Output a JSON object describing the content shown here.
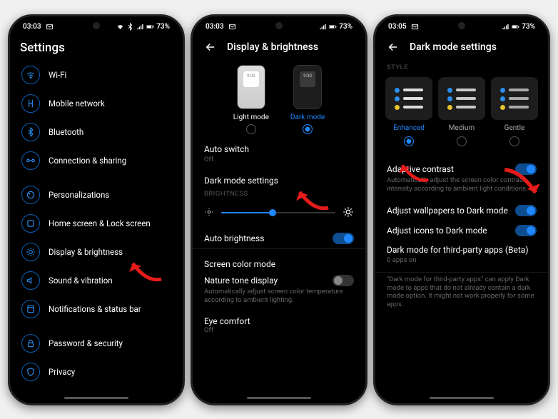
{
  "status": {
    "time_a": "03:03",
    "time_b": "03:03",
    "time_c": "03:05",
    "battery": "73%"
  },
  "screen1": {
    "title": "Settings",
    "items": [
      {
        "name": "wifi",
        "label": "Wi-Fi"
      },
      {
        "name": "mobile",
        "label": "Mobile network"
      },
      {
        "name": "bluetooth",
        "label": "Bluetooth"
      },
      {
        "name": "connection",
        "label": "Connection & sharing"
      },
      {
        "name": "personal",
        "label": "Personalizations"
      },
      {
        "name": "home",
        "label": "Home screen & Lock screen"
      },
      {
        "name": "display",
        "label": "Display & brightness"
      },
      {
        "name": "sound",
        "label": "Sound & vibration"
      },
      {
        "name": "notif",
        "label": "Notifications & status bar"
      },
      {
        "name": "security",
        "label": "Password & security"
      },
      {
        "name": "privacy",
        "label": "Privacy"
      }
    ]
  },
  "screen2": {
    "title": "Display & brightness",
    "light_label": "Light mode",
    "dark_label": "Dark mode",
    "mock_time_a": "9:00",
    "mock_time_b": "9:30",
    "autoswitch": "Auto switch",
    "autoswitch_sub": "Off",
    "darkmode_settings": "Dark mode settings",
    "brightness_caption": "BRIGHTNESS",
    "slider_pct": 45,
    "auto_brightness": "Auto brightness",
    "screen_color": "Screen color mode",
    "nature_tone": "Nature tone display",
    "nature_tone_sub": "Automatically adjust screen color temperature according to ambient lighting.",
    "eye_comfort": "Eye comfort",
    "eye_comfort_sub": "Off"
  },
  "screen3": {
    "title": "Dark mode settings",
    "style_caption": "STYLE",
    "styles": [
      {
        "label": "Enhanced",
        "selected": true
      },
      {
        "label": "Medium",
        "selected": false
      },
      {
        "label": "Gentle",
        "selected": false
      }
    ],
    "adaptive": "Adaptive contrast",
    "adaptive_sub": "Automatically adjust the screen color contrast intensity according to ambient light conditions.",
    "wallpapers": "Adjust wallpapers to Dark mode",
    "icons": "Adjust icons to Dark mode",
    "thirdparty": "Dark mode for third-party apps (Beta)",
    "thirdparty_sub": "0 apps on",
    "footer": "\"Dark mode for third-party apps\" can apply Dark mode to apps that do not already contain a dark mode option. It might not work properly for some apps."
  },
  "colors": {
    "accent": "#1f87ff",
    "arrow": "#e61b1b",
    "dot_blue": "#2a8ff0",
    "dot_yellow": "#e8c32e"
  }
}
